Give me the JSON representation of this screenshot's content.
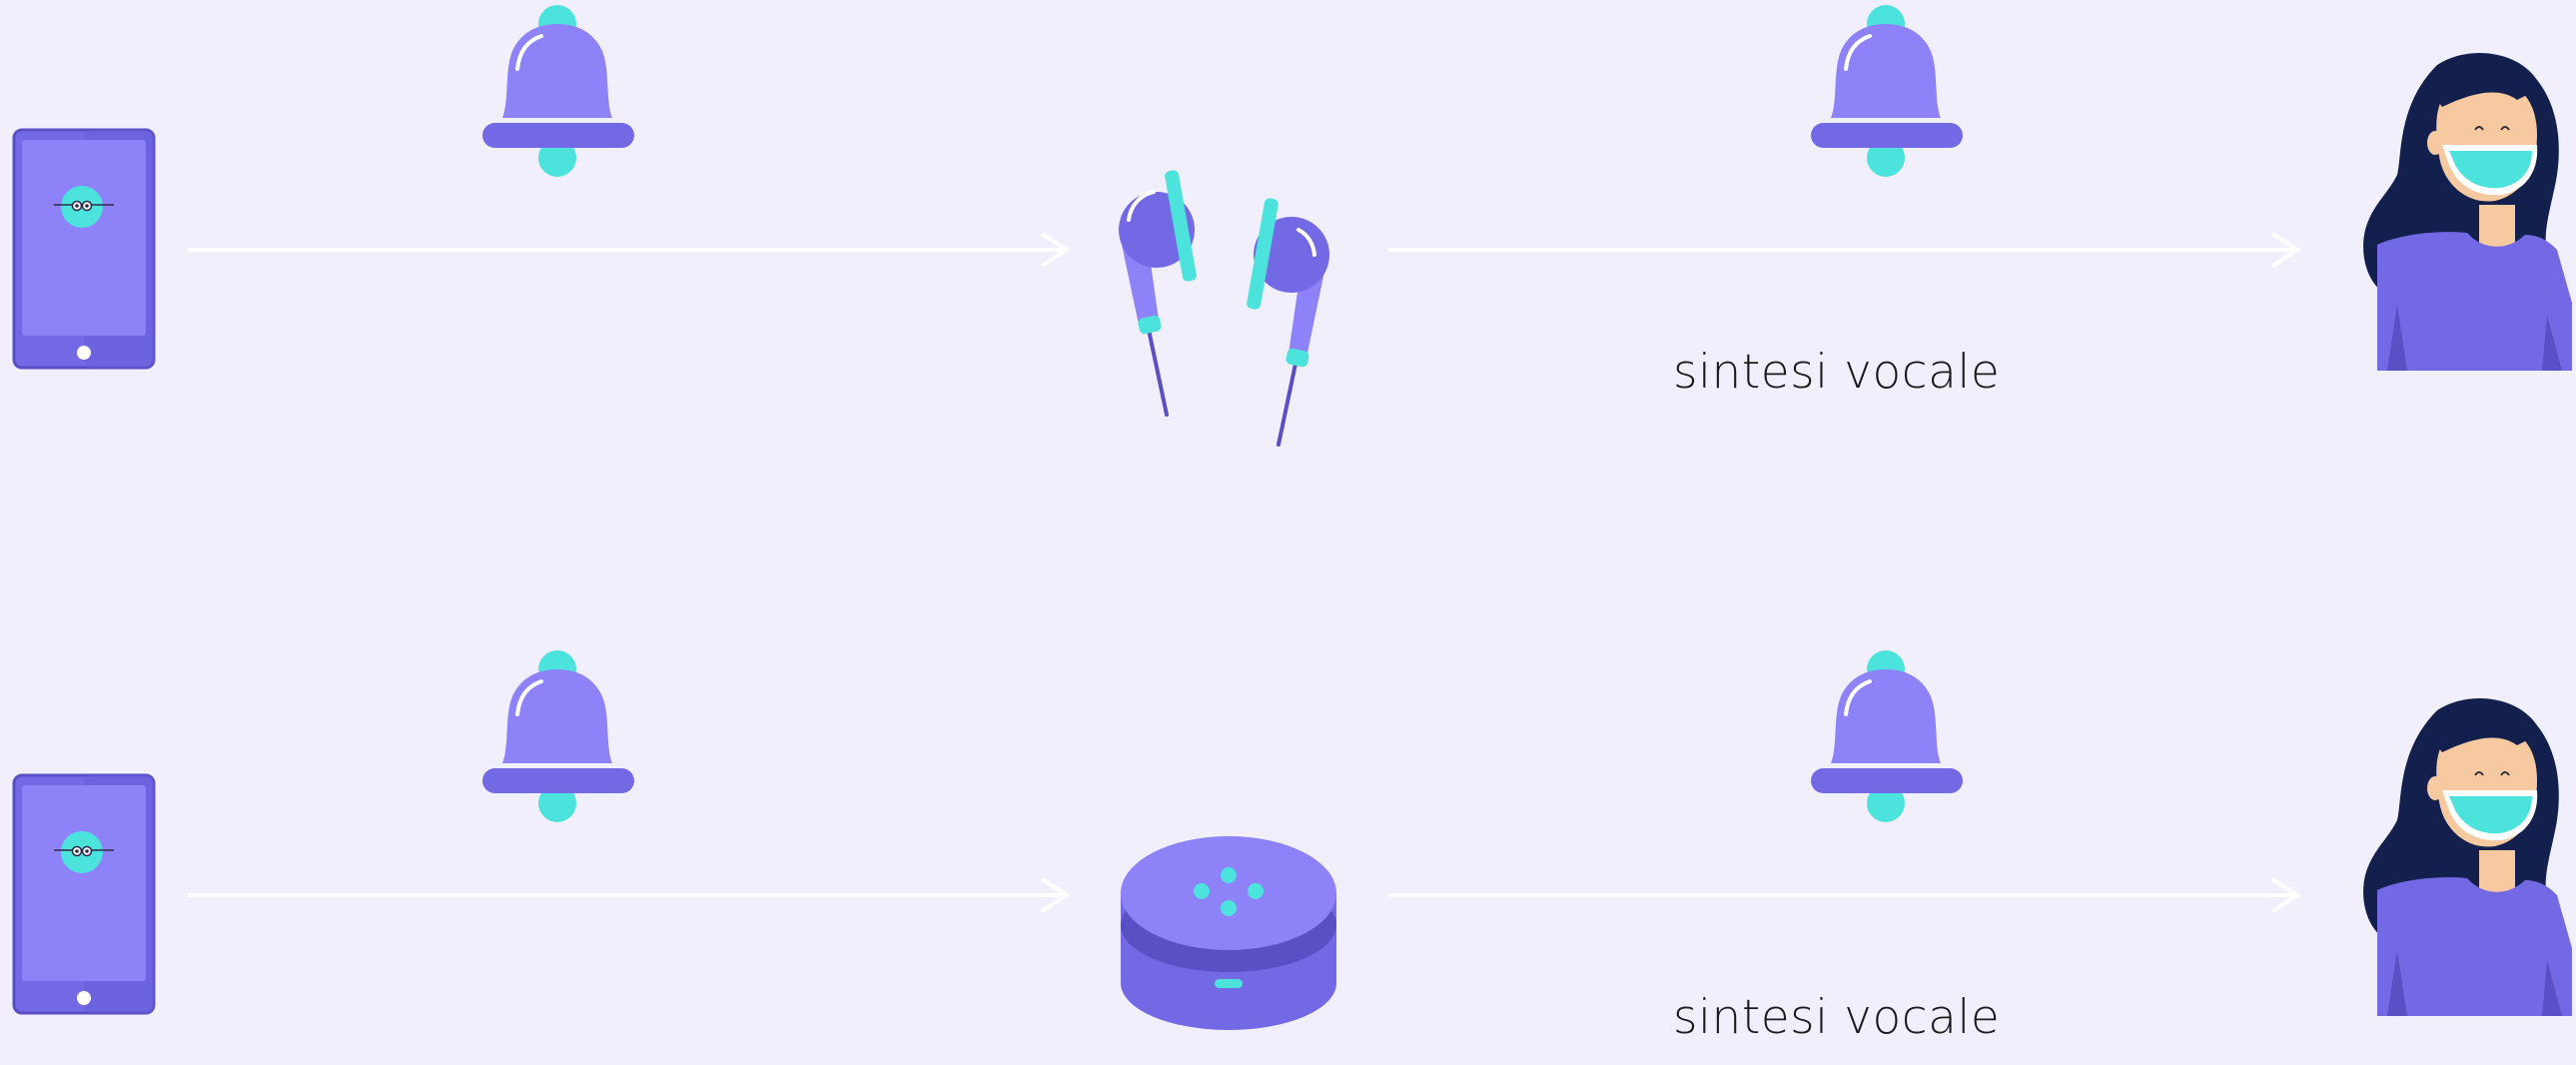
{
  "colors": {
    "background": "#f1effb",
    "purple_light": "#8d82f7",
    "purple_mid": "#7469e5",
    "purple_dark": "#5a4fc4",
    "turquoise": "#4de3dd",
    "hair": "#13204d",
    "skin": "#f7c9a0",
    "arrow": "#ffffff"
  },
  "icons": [
    "smartphone-icon",
    "bell-icon",
    "earphones-icon",
    "smart-speaker-icon",
    "woman-avatar-icon",
    "arrow-icon"
  ],
  "rows": [
    {
      "caption": "sintesi vocale",
      "device": "earphones"
    },
    {
      "caption": "sintesi vocale",
      "device": "smart-speaker"
    }
  ]
}
